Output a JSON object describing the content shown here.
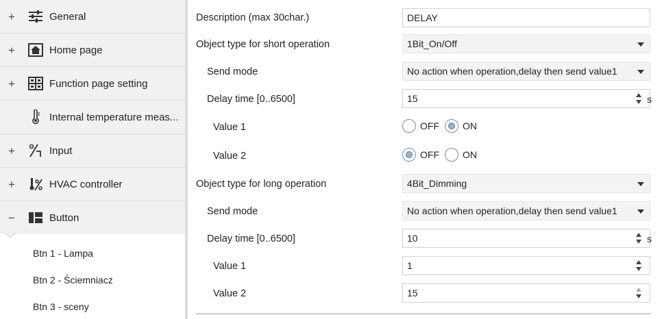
{
  "sidebar": {
    "items": [
      {
        "expander": "+",
        "icon": "sliders-icon",
        "label": "General"
      },
      {
        "expander": "+",
        "icon": "home-icon",
        "label": "Home page"
      },
      {
        "expander": "+",
        "icon": "grid-icon",
        "label": "Function page setting"
      },
      {
        "expander": "",
        "icon": "thermometer-icon",
        "label": "Internal temperature meas..."
      },
      {
        "expander": "+",
        "icon": "input-icon",
        "label": "Input"
      },
      {
        "expander": "+",
        "icon": "hvac-icon",
        "label": "HVAC controller"
      },
      {
        "expander": "−",
        "icon": "button-icon",
        "label": "Button"
      }
    ],
    "sub_items": [
      "Btn 1 - Lampa",
      "Btn 2 - Ściemniacz",
      "Btn 3 - sceny"
    ]
  },
  "form": {
    "description": {
      "label": "Description (max 30char.)",
      "value": "DELAY"
    },
    "short_type": {
      "label": "Object type for short operation",
      "value": "1Bit_On/Off"
    },
    "short_send_mode": {
      "label": "Send mode",
      "value": "No action when operation,delay then send value1"
    },
    "short_delay": {
      "label": "Delay time [0..6500]",
      "value": "15",
      "unit": "s"
    },
    "short_value1": {
      "label": "Value 1",
      "options": [
        "OFF",
        "ON"
      ],
      "selected": "ON"
    },
    "short_value2": {
      "label": "Value 2",
      "options": [
        "OFF",
        "ON"
      ],
      "selected": "OFF"
    },
    "long_type": {
      "label": "Object type for long operation",
      "value": "4Bit_Dimming"
    },
    "long_send_mode": {
      "label": "Send mode",
      "value": "No action when operation,delay then send value1"
    },
    "long_delay": {
      "label": "Delay time [0..6500]",
      "value": "10",
      "unit": "s"
    },
    "long_value1": {
      "label": "Value 1",
      "value": "1"
    },
    "long_value2": {
      "label": "Value 2",
      "value": "15"
    }
  }
}
